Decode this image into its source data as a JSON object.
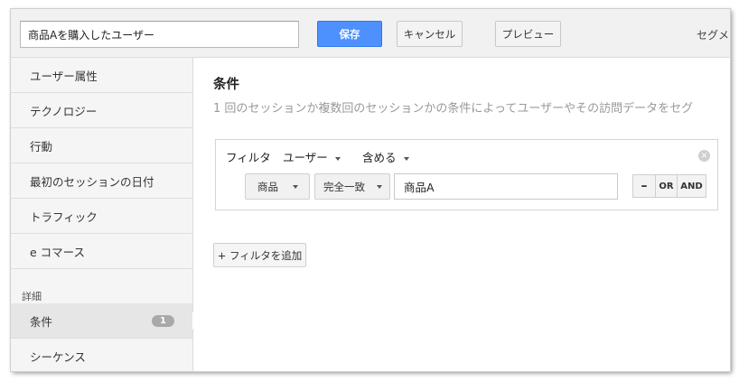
{
  "topbar": {
    "segment_name_value": "商品Aを購入したユーザー",
    "save_label": "保存",
    "cancel_label": "キャンセル",
    "preview_label": "プレビュー",
    "truncated_link": "セグメ"
  },
  "sidebar": {
    "items": [
      {
        "label": "ユーザー属性"
      },
      {
        "label": "テクノロジー"
      },
      {
        "label": "行動"
      },
      {
        "label": "最初のセッションの日付"
      },
      {
        "label": "トラフィック"
      },
      {
        "label": "e コマース"
      }
    ],
    "section_label": "詳細",
    "advanced_items": [
      {
        "label": "条件",
        "badge": "1",
        "selected": true
      },
      {
        "label": "シーケンス"
      }
    ]
  },
  "main": {
    "title": "条件",
    "description": "1 回のセッションか複数回のセッションかの条件によってユーザーやその訪問データをセグ",
    "filter": {
      "label": "フィルタ",
      "scope": "ユーザー",
      "action": "含める",
      "condition": {
        "dimension": "商品",
        "match_type": "完全一致",
        "value": "商品A"
      },
      "logic": {
        "minus": "–",
        "or": "OR",
        "and": "AND"
      }
    },
    "add_filter_label": "+ フィルタを追加"
  },
  "colors": {
    "primary_button": "#4d90fe",
    "badge": "#a9a9a9",
    "description_text": "#999999"
  }
}
